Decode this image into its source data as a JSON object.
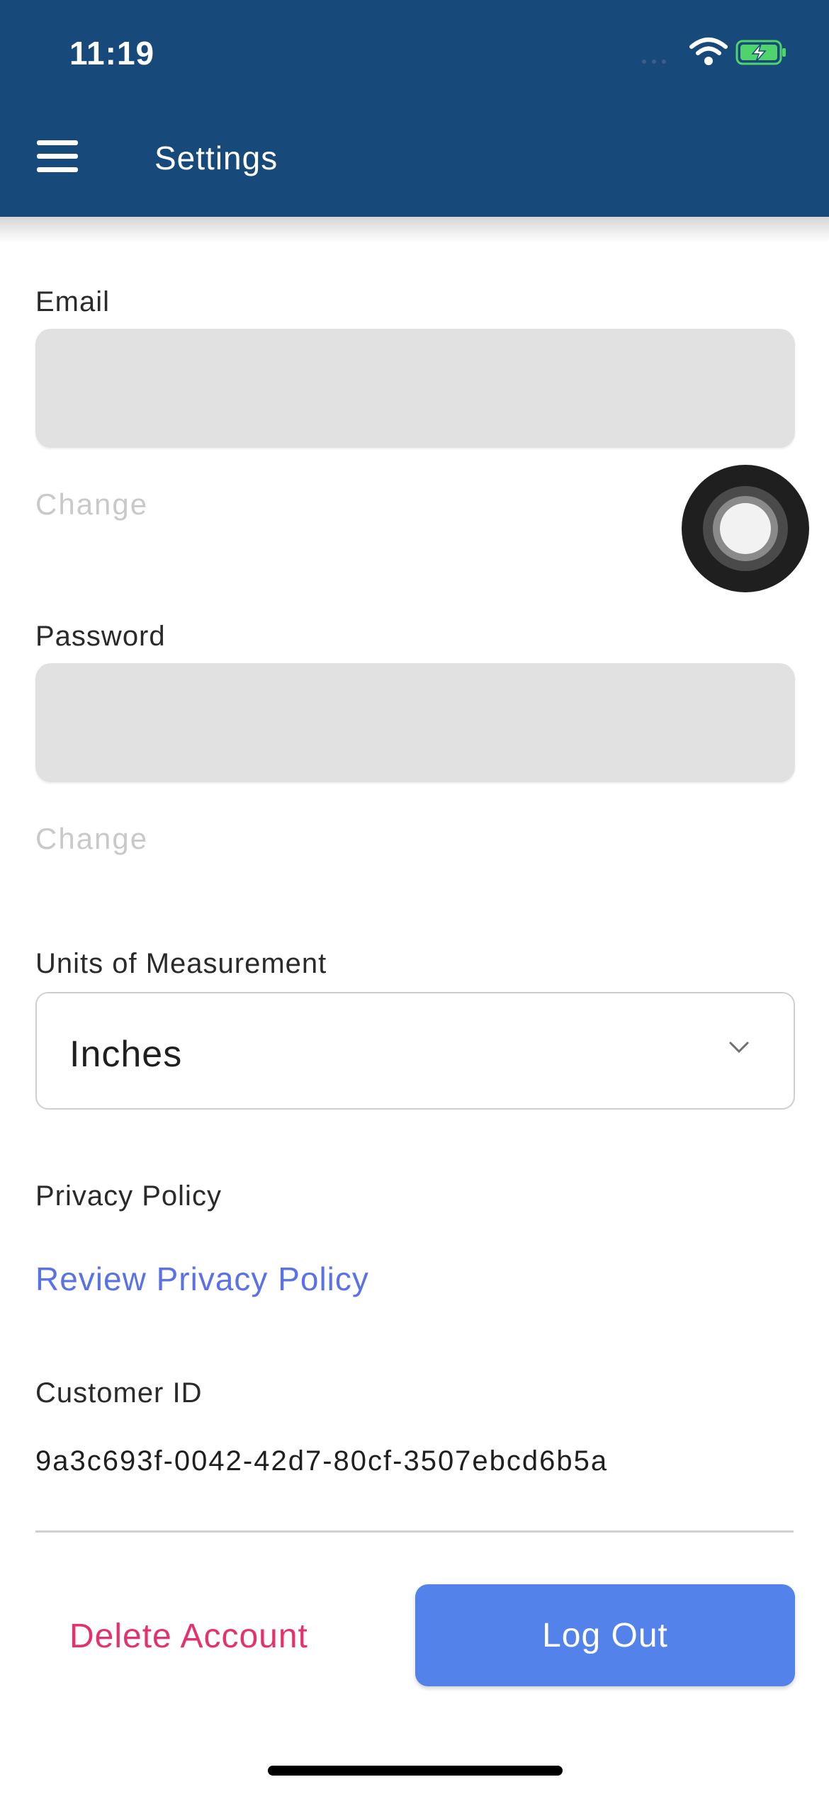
{
  "status_bar": {
    "time": "11:19",
    "icons": [
      "signal-icon",
      "wifi-icon",
      "battery-charging-icon"
    ]
  },
  "app_bar": {
    "menu_icon": "hamburger-menu-icon",
    "title": "Settings"
  },
  "email": {
    "label": "Email",
    "value": "",
    "change_label": "Change"
  },
  "password": {
    "label": "Password",
    "value": "",
    "change_label": "Change"
  },
  "units": {
    "label": "Units of Measurement",
    "selected": "Inches"
  },
  "privacy": {
    "label": "Privacy Policy",
    "link": "Review Privacy Policy"
  },
  "customer": {
    "label": "Customer ID",
    "id": "9a3c693f-0042-42d7-80cf-3507ebcd6b5a"
  },
  "actions": {
    "delete_label": "Delete Account",
    "logout_label": "Log Out"
  },
  "colors": {
    "app_bar": "#174a7a",
    "link": "#5b72e6",
    "danger": "#e2336d",
    "primary_button": "#5282ea"
  }
}
